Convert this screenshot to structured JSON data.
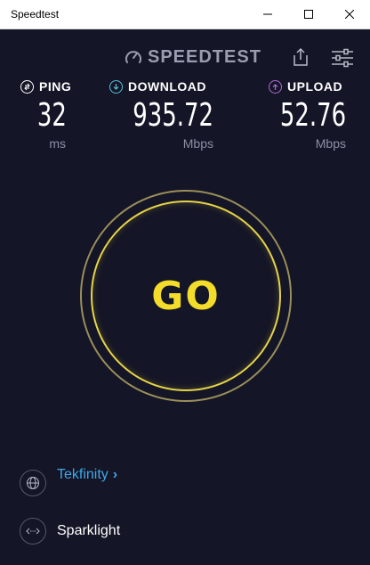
{
  "window": {
    "title": "Speedtest",
    "controls": [
      "minimize",
      "maximize",
      "close"
    ]
  },
  "header": {
    "brand": "SPEEDTEST",
    "brand_icon": "speedometer-icon",
    "share_icon": "share-icon",
    "settings_icon": "settings-icon"
  },
  "metrics": {
    "ping": {
      "label": "PING",
      "value": "32",
      "unit": "ms",
      "icon": "ping-icon",
      "color": "#ffffff"
    },
    "download": {
      "label": "DOWNLOAD",
      "value": "935.72",
      "unit": "Mbps",
      "icon": "download-arrow-icon",
      "color": "#59c1dd"
    },
    "upload": {
      "label": "UPLOAD",
      "value": "52.76",
      "unit": "Mbps",
      "icon": "upload-arrow-icon",
      "color": "#b06ad6"
    }
  },
  "go_button": {
    "label": "GO",
    "color": "#f3dc2a"
  },
  "providers": {
    "isp": {
      "label": "Tekfinity",
      "suffix": "›",
      "icon": "globe-icon",
      "color": "#3fa7e8"
    },
    "server": {
      "label": "Sparklight",
      "icon": "server-arrows-icon"
    }
  }
}
